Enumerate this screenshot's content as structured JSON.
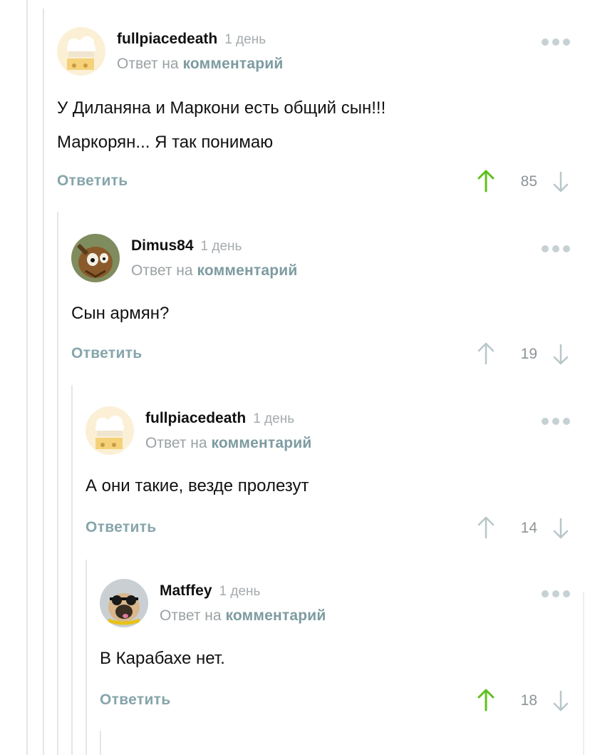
{
  "comments": [
    {
      "author": "fullpiacedeath",
      "time": "1 день",
      "reply_prefix": "Ответ на",
      "reply_link": "комментарий",
      "lines": [
        "У Диланяна и Маркони есть общий сын!!!",
        "Маркорян... Я так понимаю"
      ],
      "reply_label": "Ответить",
      "rating": "85",
      "upvoted": true,
      "avatar_icon": "chef-hat-icon"
    },
    {
      "author": "Dimus84",
      "time": "1 день",
      "reply_prefix": "Ответ на",
      "reply_link": "комментарий",
      "lines": [
        "Сын армян?"
      ],
      "reply_label": "Ответить",
      "rating": "19",
      "upvoted": false,
      "avatar_icon": "squirrel-photo-icon"
    },
    {
      "author": "fullpiacedeath",
      "time": "1 день",
      "reply_prefix": "Ответ на",
      "reply_link": "комментарий",
      "lines": [
        "А они такие, везде пролезут"
      ],
      "reply_label": "Ответить",
      "rating": "14",
      "upvoted": false,
      "avatar_icon": "chef-hat-icon"
    },
    {
      "author": "Matffey",
      "time": "1 день",
      "reply_prefix": "Ответ на",
      "reply_link": "комментарий",
      "lines": [
        "В Карабахе нет."
      ],
      "reply_label": "Ответить",
      "rating": "18",
      "upvoted": true,
      "avatar_icon": "pug-photo-icon"
    }
  ],
  "colors": {
    "upvote_active": "#5fbf1e",
    "vote_inactive": "#b8c6c9",
    "link": "#7d9ba1",
    "thread_line": "#e3e6e8"
  }
}
